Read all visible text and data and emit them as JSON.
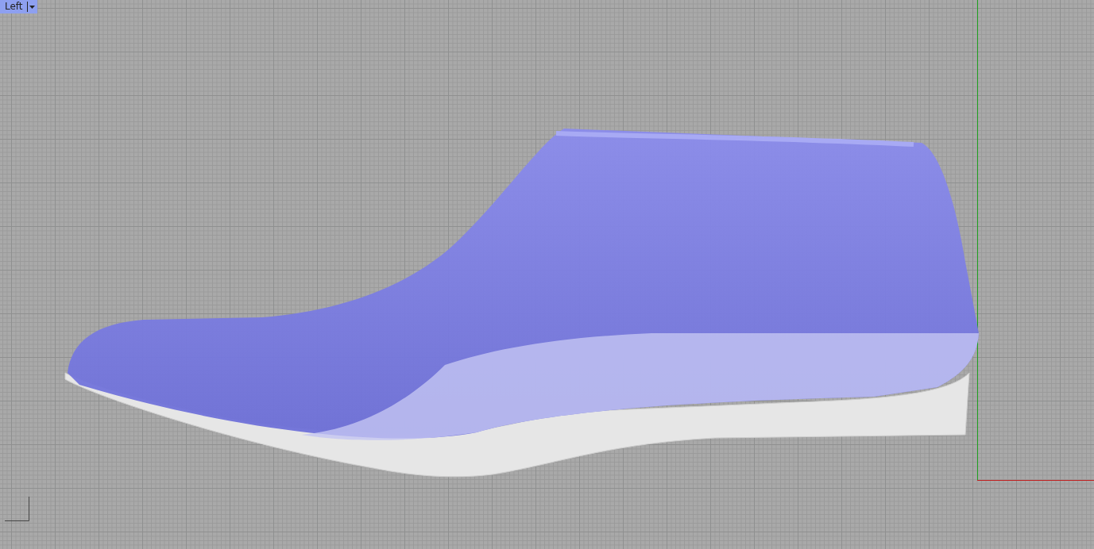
{
  "viewport": {
    "tab": {
      "label": "Left",
      "selected": true
    }
  }
}
